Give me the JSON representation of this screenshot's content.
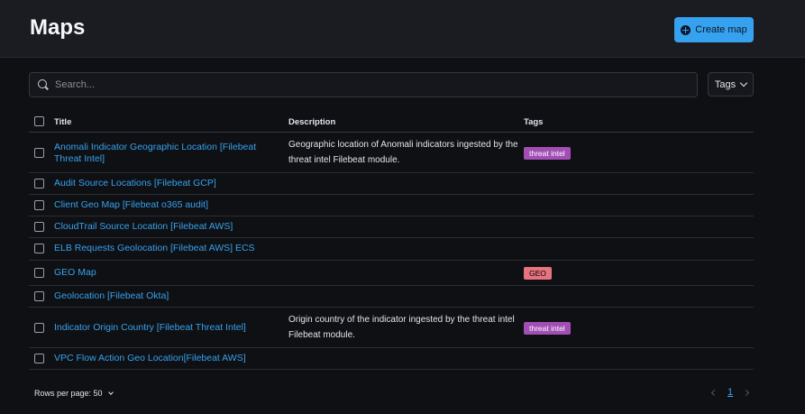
{
  "header": {
    "title": "Maps",
    "create_label": "Create map"
  },
  "search": {
    "placeholder": "Search...",
    "value": ""
  },
  "filters": {
    "tags_label": "Tags"
  },
  "table": {
    "columns": [
      "Title",
      "Description",
      "Tags"
    ],
    "rows": [
      {
        "title": "Anomali Indicator Geographic Location [Filebeat Threat Intel]",
        "description": "Geographic location of Anomali indicators ingested by the threat intel Filebeat module.",
        "tag": "threat intel"
      },
      {
        "title": "Audit Source Locations [Filebeat GCP]",
        "description": "",
        "tag": ""
      },
      {
        "title": "Client Geo Map [Filebeat o365 audit]",
        "description": "",
        "tag": ""
      },
      {
        "title": "CloudTrail Source Location [Filebeat AWS]",
        "description": "",
        "tag": ""
      },
      {
        "title": "ELB Requests Geolocation [Filebeat AWS] ECS",
        "description": "",
        "tag": ""
      },
      {
        "title": "GEO Map",
        "description": "",
        "tag": "GEO"
      },
      {
        "title": "Geolocation [Filebeat Okta]",
        "description": "",
        "tag": ""
      },
      {
        "title": "Indicator Origin Country [Filebeat Threat Intel]",
        "description": "Origin country of the indicator ingested by the threat intel Filebeat module.",
        "tag": "threat intel"
      },
      {
        "title": "VPC Flow Action Geo Location[Filebeat AWS]",
        "description": "",
        "tag": ""
      }
    ]
  },
  "footer": {
    "rows_per_page": "Rows per page: 50",
    "current_page": "1"
  },
  "colors": {
    "accent": "#36a2ef",
    "tag_threat_intel": "#a24eb5",
    "tag_geo": "#e7737f"
  }
}
